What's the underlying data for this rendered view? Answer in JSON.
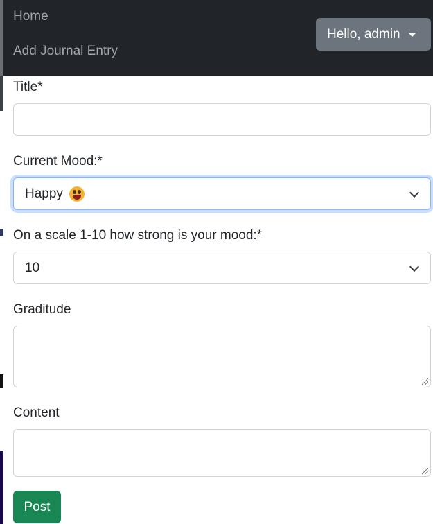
{
  "nav": {
    "home": "Home",
    "add_entry": "Add Journal Entry",
    "user_menu": "Hello, admin"
  },
  "form": {
    "title_label": "Title*",
    "title_value": "",
    "mood_label": "Current Mood:*",
    "mood_selected": "Happy",
    "mood_icon": "grinning-face-emoji",
    "strength_label": "On a scale 1-10 how strong is your mood:*",
    "strength_selected": "10",
    "gratitude_label": "Graditude",
    "gratitude_value": "",
    "content_label": "Content",
    "content_value": "",
    "submit_label": "Post"
  },
  "colors": {
    "navbar_bg": "#212529",
    "user_button_bg": "#6c757d",
    "submit_bg": "#198754",
    "focus_border": "#86b7fe"
  }
}
